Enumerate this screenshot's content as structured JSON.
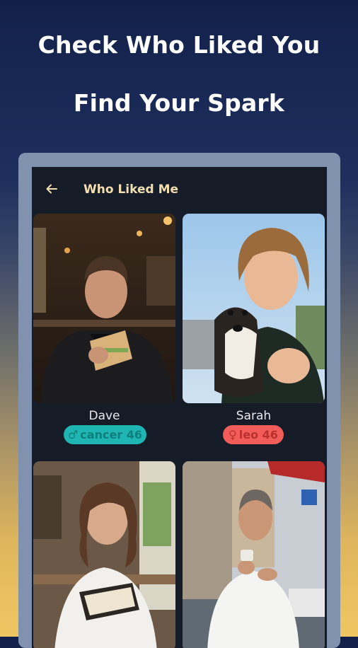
{
  "headline": {
    "line1": "Check Who Liked You",
    "line2": "Find Your Spark"
  },
  "appbar": {
    "title": "Who Liked Me",
    "back_icon": "arrow-left-icon"
  },
  "colors": {
    "accent_title": "#f2deb0",
    "badge_male_bg": "#1fb5b3",
    "badge_male_text": "#0f7f7e",
    "badge_female_bg": "#f25d5a",
    "badge_female_text": "#b8322f",
    "phone_bg": "#151b27"
  },
  "profiles": [
    {
      "name": "Dave",
      "gender_symbol": "♂",
      "badge_text": "cancer 46",
      "gender": "male"
    },
    {
      "name": "Sarah",
      "gender_symbol": "♀",
      "badge_text": "leo 46",
      "gender": "female"
    },
    {
      "name": "",
      "gender_symbol": "",
      "badge_text": "",
      "gender": "female"
    },
    {
      "name": "",
      "gender_symbol": "",
      "badge_text": "",
      "gender": "male"
    }
  ]
}
